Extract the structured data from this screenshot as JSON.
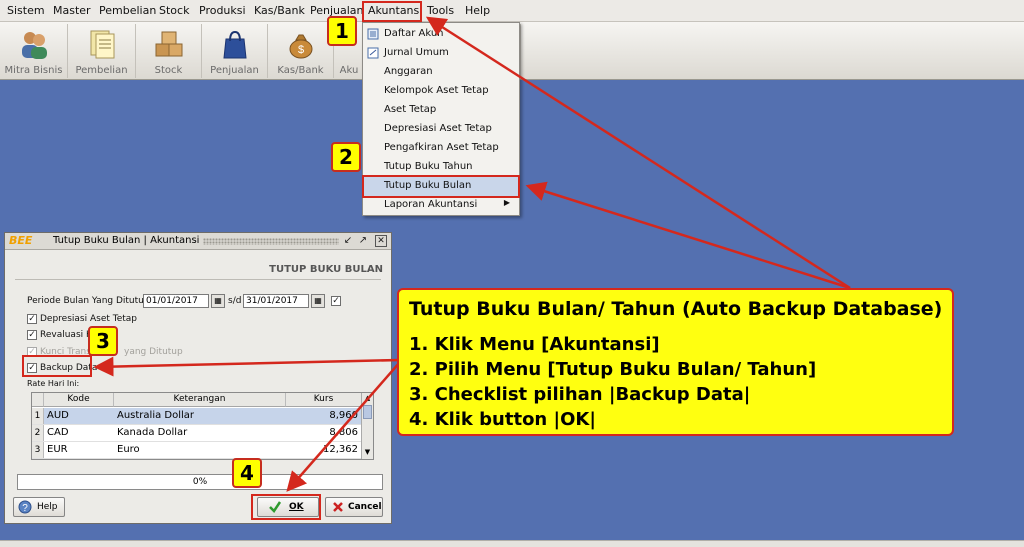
{
  "menubar": {
    "items": [
      "Sistem",
      "Master",
      "Pembelian",
      "Stock",
      "Produksi",
      "Kas/Bank",
      "Penjualan",
      "Akuntansi",
      "Tools",
      "Help"
    ]
  },
  "toolbar": {
    "buttons": [
      "Mitra Bisnis",
      "Pembelian",
      "Stock",
      "Penjualan",
      "Kas/Bank",
      "Aku"
    ]
  },
  "dropdown": {
    "items": [
      "Daftar Akun",
      "Jurnal Umum",
      "Anggaran",
      "Kelompok Aset Tetap",
      "Aset Tetap",
      "Depresiasi Aset Tetap",
      "Pengafkiran Aset Tetap",
      "Tutup Buku Tahun",
      "Tutup Buku Bulan",
      "Laporan Akuntansi"
    ],
    "active_item": "Tutup Buku Bulan"
  },
  "dialog": {
    "logo": "BEE",
    "title": "Tutup Buku Bulan | Akuntansi",
    "heading": "TUTUP BUKU BULAN",
    "periode_label": "Periode Bulan Yang Ditutup:",
    "date_from": "01/01/2017",
    "date_sep": "s/d",
    "date_to": "31/01/2017",
    "opt_depresiasi": "Depresiasi Aset Tetap",
    "opt_revaluasi": "Revaluasi K",
    "opt_kunci_a": "Kunci Trans",
    "opt_kunci_b": "yang Ditutup",
    "opt_backup": "Backup Data",
    "rate_label": "Rate Hari Ini:",
    "columns": [
      "Kode",
      "Keterangan",
      "Kurs"
    ],
    "rows": [
      {
        "no": "1",
        "kode": "AUD",
        "keterangan": "Australia Dollar",
        "kurs": "8,960"
      },
      {
        "no": "2",
        "kode": "CAD",
        "keterangan": "Kanada Dollar",
        "kurs": "8,806"
      },
      {
        "no": "3",
        "kode": "EUR",
        "keterangan": "Euro",
        "kurs": "12,362"
      }
    ],
    "progress_text": "0%",
    "progress_value": 0,
    "help_label": "Help",
    "ok_label": "OK",
    "cancel_label": "Cancel"
  },
  "annotations": {
    "badges": [
      "1",
      "2",
      "3",
      "4"
    ],
    "callout": {
      "title": "Tutup Buku Bulan/ Tahun (Auto Backup Database)",
      "steps": [
        "1. Klik Menu [Akuntansi]",
        "2. Pilih Menu [Tutup Buku Bulan/ Tahun]",
        "3. Checklist pilihan |Backup Data|",
        "4. Klik button |OK|"
      ]
    }
  },
  "colors": {
    "desktop": "#5470b0",
    "highlight": "#d4281d",
    "callout_bg": "#ffff10",
    "ok_icon": "#2e9a2e",
    "cancel_icon": "#cc2222"
  }
}
